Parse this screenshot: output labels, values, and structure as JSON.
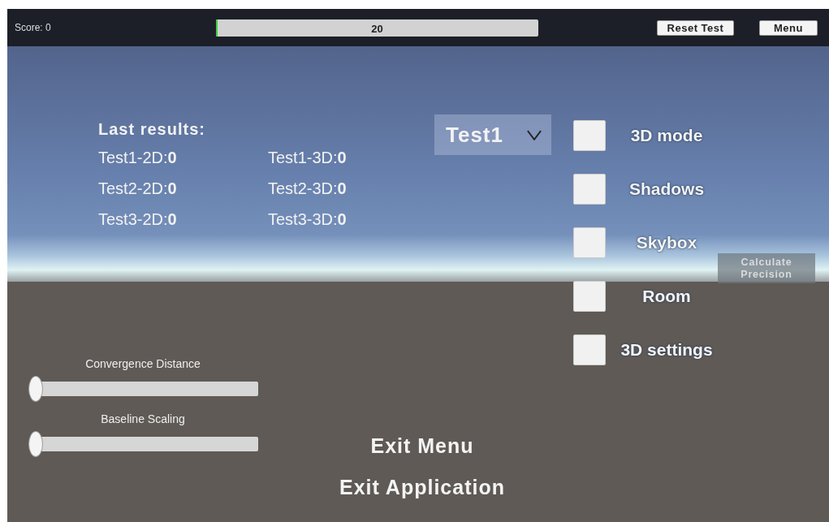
{
  "top_bar": {
    "score": "Score: 0",
    "progress": {
      "label": "20",
      "level": 0.005
    },
    "buttons": [
      "Reset Test",
      "Menu"
    ]
  },
  "results": {
    "title": "Last results:",
    "items": [
      {
        "text": "Test1-2D:**0**"
      },
      {
        "text": "Test1-3D:**0**"
      },
      {
        "text": "Test2-2D:**0**"
      },
      {
        "text": "Test2-3D:**0**"
      },
      {
        "text": "Test3-2D:**0**"
      },
      {
        "text": "Test3-3D:**0**"
      }
    ]
  },
  "test_dropdown": {
    "value": "Test1"
  },
  "toggles": [
    {
      "label": "3D mode",
      "checked": false
    },
    {
      "label": "Shadows",
      "checked": false
    },
    {
      "label": "Skybox",
      "checked": false
    },
    {
      "label": "Room",
      "checked": false
    },
    {
      "label": "3D settings",
      "checked": false
    }
  ],
  "calculate_button": {
    "label": "Calculate Precision",
    "disabled": true
  },
  "sliders": [
    {
      "label": "Convergence Distance",
      "level": 0
    },
    {
      "label": "Baseline Scaling",
      "level": 0
    }
  ],
  "menu_actions": [
    "Exit Menu",
    "Exit Application"
  ]
}
